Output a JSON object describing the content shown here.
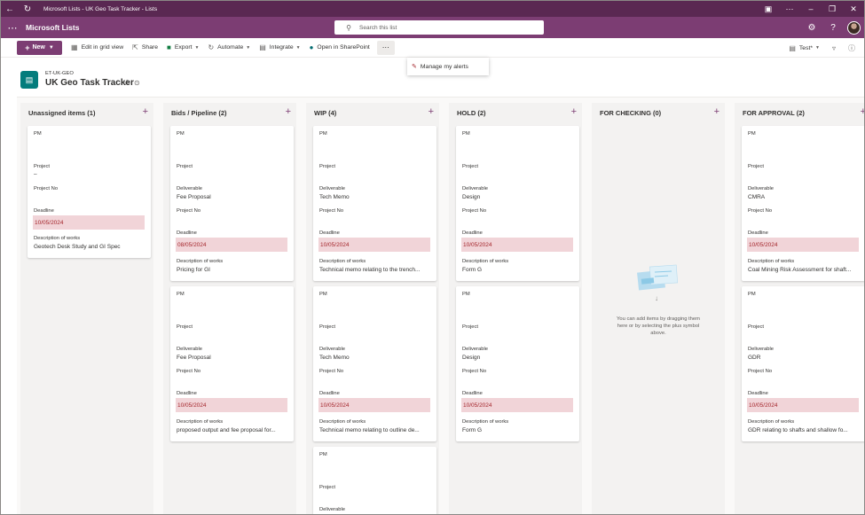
{
  "window": {
    "title": "Microsoft Lists - UK Geo Task Tracker - Lists"
  },
  "suite": {
    "app_name": "Microsoft Lists",
    "search_placeholder": "Search this list"
  },
  "commands": {
    "new_label": "New",
    "edit_grid": "Edit in grid view",
    "share": "Share",
    "export": "Export",
    "automate": "Automate",
    "integrate": "Integrate",
    "open_sharepoint": "Open in SharePoint",
    "view_name": "Test*"
  },
  "dropdown": {
    "manage_alerts": "Manage my alerts"
  },
  "list": {
    "site": "ET-UK-GEO",
    "title": "UK Geo Task Tracker"
  },
  "fields": {
    "pm": "PM",
    "project": "Project",
    "project_no": "Project No",
    "deliverable": "Deliverable",
    "deadline": "Deadline",
    "description": "Description of works"
  },
  "columns": [
    {
      "title": "Unassigned items (1)",
      "cards": [
        {
          "project": "–",
          "deadline": "10/05/2024",
          "description": "Geotech Desk Study and GI Spec"
        }
      ]
    },
    {
      "title": "Bids / Pipeline (2)",
      "cards": [
        {
          "deliverable": "Fee Proposal",
          "deadline": "08/05/2024",
          "description": "Pricing for GI"
        },
        {
          "deliverable": "Fee Proposal",
          "deadline": "10/05/2024",
          "description": "proposed output and fee proposal for..."
        }
      ]
    },
    {
      "title": "WIP (4)",
      "cards": [
        {
          "deliverable": "Tech Memo",
          "deadline": "10/05/2024",
          "description": "Technical memo relating to the trench..."
        },
        {
          "deliverable": "Tech Memo",
          "deadline": "10/05/2024",
          "description": "Technical memo relating to outline de..."
        },
        {
          "deliverable": ""
        }
      ]
    },
    {
      "title": "HOLD (2)",
      "cards": [
        {
          "deliverable": "Design",
          "deadline": "10/05/2024",
          "description": "Form G"
        },
        {
          "deliverable": "Design",
          "deadline": "10/05/2024",
          "description": "Form G"
        }
      ]
    },
    {
      "title": "FOR CHECKING (0)",
      "empty_text": "You can add items by dragging them here or by selecting the plus symbol above."
    },
    {
      "title": "FOR APPROVAL (2)",
      "cards": [
        {
          "deliverable": "CMRA",
          "deadline": "10/05/2024",
          "description": "Coal Mining Risk Assessment for shaft..."
        },
        {
          "deliverable": "GDR",
          "deadline": "10/05/2024",
          "description": "GDR relating to shafts and shallow fo..."
        }
      ]
    }
  ],
  "colors": {
    "titlebar": "#5a2852",
    "suitebar": "#7c3d73",
    "accent": "#7c3d73",
    "deadline_bg": "#f1d4d8",
    "deadline_text": "#a4262c"
  }
}
